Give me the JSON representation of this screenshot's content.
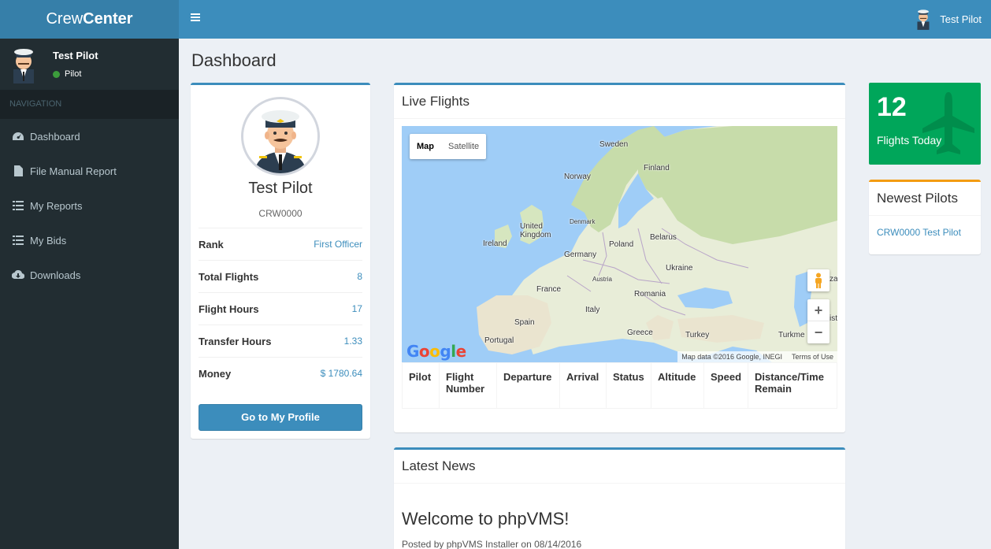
{
  "app": {
    "brand_light": "Crew",
    "brand_bold": "Center",
    "accent_color": "#3c8dbc",
    "sidebar_color": "#222d32",
    "success_color": "#00a65a",
    "warning_color": "#f39c12"
  },
  "sidebar": {
    "user_name": "Test Pilot",
    "user_status": "Pilot",
    "nav_header": "NAVIGATION",
    "items": [
      {
        "label": "Dashboard",
        "icon": "dashboard-icon"
      },
      {
        "label": "File Manual Report",
        "icon": "file-icon"
      },
      {
        "label": "My Reports",
        "icon": "list-icon"
      },
      {
        "label": "My Bids",
        "icon": "list-icon"
      },
      {
        "label": "Downloads",
        "icon": "cloud-download-icon"
      }
    ]
  },
  "topbar": {
    "menu_icon": "hamburger-icon",
    "user_name": "Test Pilot"
  },
  "page": {
    "title": "Dashboard"
  },
  "profile": {
    "name": "Test Pilot",
    "code": "CRW0000",
    "stats": [
      {
        "label": "Rank",
        "value": "First Officer"
      },
      {
        "label": "Total Flights",
        "value": "8"
      },
      {
        "label": "Flight Hours",
        "value": "17"
      },
      {
        "label": "Transfer Hours",
        "value": "1.33"
      },
      {
        "label": "Money",
        "value": "$ 1780.64"
      }
    ],
    "button_label": "Go to My Profile"
  },
  "live_flights": {
    "title": "Live Flights",
    "map": {
      "tab_map": "Map",
      "tab_satellite": "Satellite",
      "zoom_in": "+",
      "zoom_out": "−",
      "logo": "Google",
      "attribution": "Map data ©2016 Google, INEGI",
      "terms": "Terms of Use",
      "labels": [
        "Sweden",
        "Finland",
        "Norway",
        "Denmark",
        "United Kingdom",
        "Ireland",
        "Belarus",
        "Poland",
        "Germany",
        "Ukraine",
        "France",
        "Austria",
        "Romania",
        "Italy",
        "Spain",
        "Portugal",
        "Greece",
        "Turkey",
        "Turkme",
        "za",
        "ist"
      ]
    },
    "columns": [
      "Pilot",
      "Flight Number",
      "Departure",
      "Arrival",
      "Status",
      "Altitude",
      "Speed",
      "Distance/Time Remain"
    ]
  },
  "news": {
    "title": "Latest News",
    "headline": "Welcome to phpVMS!",
    "meta": "Posted by phpVMS Installer on 08/14/2016"
  },
  "flights_today": {
    "count": "12",
    "label": "Flights Today",
    "icon": "plane-icon"
  },
  "newest_pilots": {
    "title": "Newest Pilots",
    "pilots": [
      {
        "label": "CRW0000 Test Pilot"
      }
    ]
  }
}
